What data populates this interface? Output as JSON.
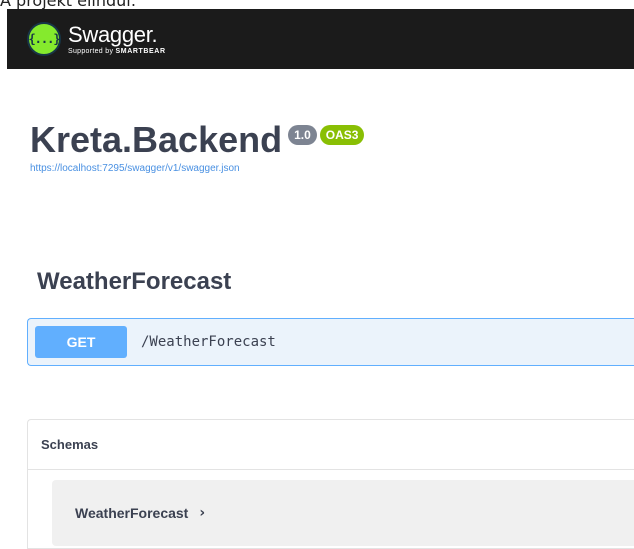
{
  "caption": "A projekt elindul:",
  "topbar": {
    "logo_icon_text": "{...}",
    "logo_name": "Swagger.",
    "logo_sub_prefix": "Supported by",
    "logo_sub_brand": "SMARTBEAR"
  },
  "info": {
    "title": "Kreta.Backend",
    "version": "1.0",
    "oas": "OAS3",
    "spec_url": "https://localhost:7295/swagger/v1/swagger.json"
  },
  "tag": {
    "name": "WeatherForecast"
  },
  "operation": {
    "method": "GET",
    "path": "/WeatherForecast"
  },
  "models": {
    "header": "Schemas",
    "items": [
      {
        "name": "WeatherForecast",
        "chevron": "›"
      }
    ]
  },
  "colors": {
    "topbar_bg": "#1b1b1b",
    "logo_green": "#85ea2d",
    "get_blue": "#61affe",
    "get_bg": "#ebf3fb",
    "oas_green": "#89bf04",
    "version_grey": "#7d8492",
    "link_blue": "#4990e2",
    "text_dark": "#3b4151"
  }
}
